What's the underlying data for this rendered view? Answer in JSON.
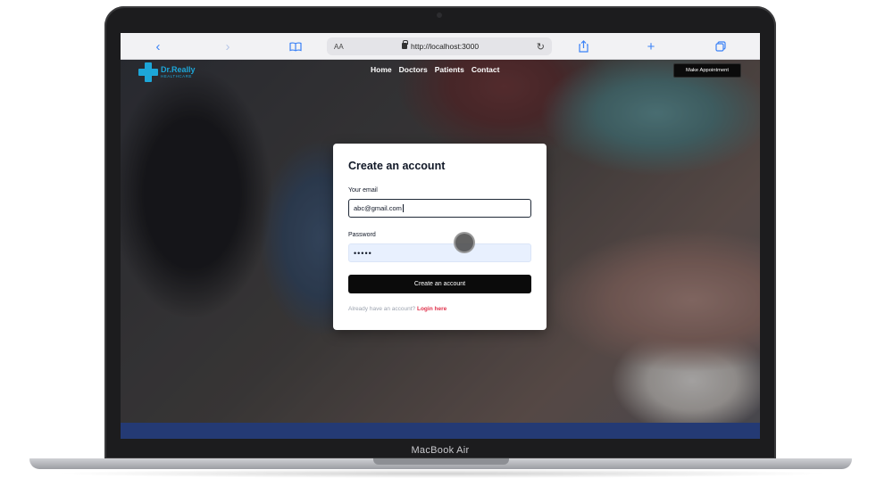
{
  "device": {
    "brand_label": "MacBook Air"
  },
  "browser": {
    "text_size_label": "AA",
    "url": "http://localhost:3000",
    "icons": {
      "back": "chevron-left-icon",
      "forward": "chevron-right-icon",
      "reader": "book-icon",
      "reload": "reload-icon",
      "share": "share-icon",
      "new_tab": "plus-icon",
      "tabs": "tabs-icon"
    }
  },
  "site": {
    "logo": {
      "name": "Dr.Really",
      "subtitle": "HEALTHCARE"
    },
    "nav": {
      "links": [
        "Home",
        "Doctors",
        "Patients",
        "Contact"
      ],
      "cta_label": "Make Appointment"
    },
    "colors": {
      "brand": "#1da6d8",
      "accent_link": "#e0314b",
      "button": "#0b0b0b",
      "footer_band": "#243a74"
    }
  },
  "form": {
    "title": "Create an account",
    "email_label": "Your email",
    "email_value": "abc@gmail.com",
    "password_label": "Password",
    "password_value": "•••••",
    "submit_label": "Create an account",
    "login_prompt": "Already have an account?",
    "login_link": "Login here"
  }
}
